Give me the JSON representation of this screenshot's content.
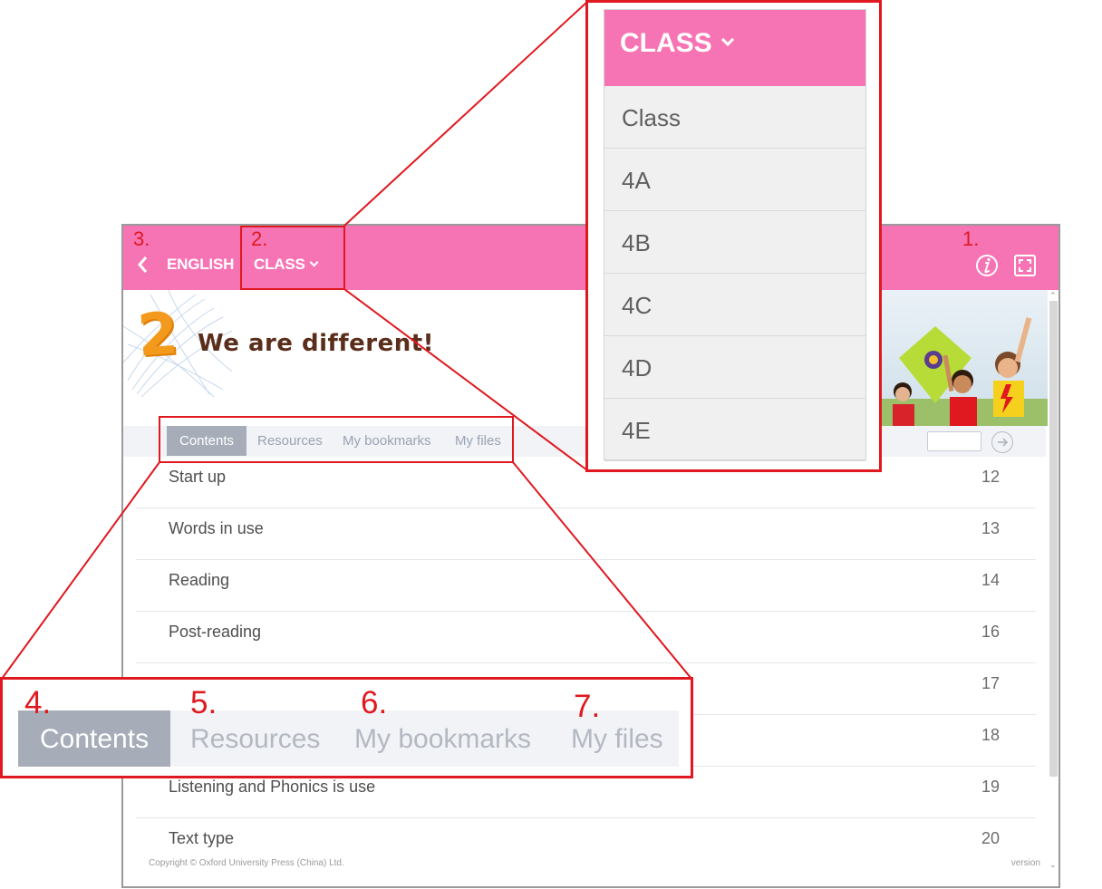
{
  "header": {
    "back_icon": "chevron-left-icon",
    "subject": "ENGLISH",
    "class_label": "CLASS",
    "info_icon": "info-icon",
    "fullscreen_icon": "fullscreen-icon",
    "bg_color": "#f774b4"
  },
  "banner": {
    "unit_number": "2",
    "unit_title": "We are different!"
  },
  "tabs": [
    {
      "label": "Contents",
      "active": true
    },
    {
      "label": "Resources",
      "active": false
    },
    {
      "label": "My bookmarks",
      "active": false
    },
    {
      "label": "My files",
      "active": false
    }
  ],
  "contents": [
    {
      "title": "Start up",
      "page": "12"
    },
    {
      "title": "Words in use",
      "page": "13"
    },
    {
      "title": "Reading",
      "page": "14"
    },
    {
      "title": "Post-reading",
      "page": "16"
    },
    {
      "title": "",
      "page": "17"
    },
    {
      "title": "",
      "page": "18"
    },
    {
      "title": "Listening and Phonics is use",
      "page": "19"
    },
    {
      "title": "Text type",
      "page": "20"
    }
  ],
  "footer": {
    "copyright": "Copyright © Oxford University Press (China) Ltd.",
    "version": "version"
  },
  "class_dropdown": {
    "header": "CLASS",
    "options": [
      "Class",
      "4A",
      "4B",
      "4C",
      "4D",
      "4E"
    ]
  },
  "callouts": {
    "n1": "1.",
    "n2": "2.",
    "n3": "3.",
    "n4": "4.",
    "n5": "5.",
    "n6": "6.",
    "n7": "7."
  },
  "accent_red": "#e0181f"
}
